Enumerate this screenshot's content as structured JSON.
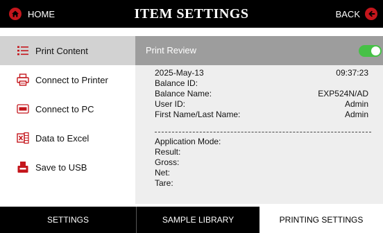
{
  "header": {
    "home_label": "HOME",
    "title": "ITEM SETTINGS",
    "back_label": "BACK"
  },
  "sidebar": {
    "items": [
      {
        "label": "Print Content",
        "icon": "list-icon",
        "active": true
      },
      {
        "label": "Connect to Printer",
        "icon": "printer-icon"
      },
      {
        "label": "Connect to PC",
        "icon": "pc-icon"
      },
      {
        "label": "Data to Excel",
        "icon": "excel-icon"
      },
      {
        "label": "Save to USB",
        "icon": "usb-icon"
      }
    ]
  },
  "print_review": {
    "label": "Print Review",
    "enabled": true
  },
  "receipt": {
    "date": "2025-May-13",
    "time": "09:37:23",
    "balance_id_label": "Balance ID:",
    "balance_name_label": "Balance Name:",
    "balance_name_value": "EXP524N/AD",
    "user_id_label": "User ID:",
    "user_id_value": "Admin",
    "name_label": "First Name/Last Name:",
    "name_value": "Admin",
    "application_mode_label": "Application Mode:",
    "result_label": "Result:",
    "gross_label": "Gross:",
    "net_label": "Net:",
    "tare_label": "Tare:"
  },
  "tabs": [
    {
      "label": "SETTINGS"
    },
    {
      "label": "SAMPLE LIBRARY"
    },
    {
      "label": "PRINTING SETTINGS",
      "active": true
    }
  ],
  "colors": {
    "accent": "#c4161c",
    "toggle_on": "#46c146",
    "header_row": "#9d9d9d",
    "content_bg": "#eeeeee",
    "active_item": "#d2d2d2"
  }
}
